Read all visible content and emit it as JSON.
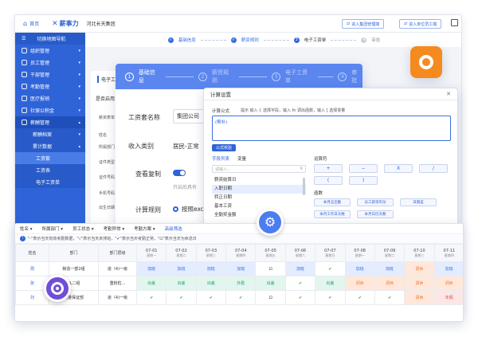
{
  "topbar": {
    "home": "首页",
    "brand": "薪事力",
    "company": "河北长天集团",
    "btn_group": "进入集团管理端",
    "btn_unit": "进入单位员工端"
  },
  "sidebar": {
    "toggle": "切换地图导航",
    "items": [
      {
        "label": "组织管理"
      },
      {
        "label": "员工管理"
      },
      {
        "label": "干部管理"
      },
      {
        "label": "考勤管理"
      },
      {
        "label": "医疗报销"
      },
      {
        "label": "社保公积金"
      },
      {
        "label": "薪酬管理"
      },
      {
        "label": "薪酬档案"
      },
      {
        "label": "累计数据"
      },
      {
        "label": "工资套"
      },
      {
        "label": "工资表"
      },
      {
        "label": "电子工资单"
      }
    ]
  },
  "steps": {
    "s1": "基础信息",
    "s2": "薪资规则",
    "s3": "电子工资单",
    "s4": "审批"
  },
  "bg_panel": {
    "tab": "电子工",
    "q": "是否启用",
    "labels": [
      "薪资表单",
      "姓名",
      "所属部门",
      "证件类型",
      "证件号码",
      "手机号码",
      "出生日期"
    ]
  },
  "mid": {
    "steps": [
      "基础信息",
      "薪资规则",
      "电子工资单",
      "审批"
    ],
    "name_label": "工资套名称",
    "name_value": "集团公司",
    "income_label": "收入类别",
    "income_value": "居民-正常",
    "copy_label": "查看复制",
    "copy_hint": "开启后具有",
    "rule_label": "计算规则",
    "rule_value": "按照exc"
  },
  "dialog": {
    "title": "计算设置",
    "formula_label": "计算公式",
    "hint": "提示 输入 { 选择字段，输入 fn 调出函数，输入 [ 选择变量",
    "placeholder": "(帮补)",
    "verify_btn": "公式校验",
    "tabs": [
      "字段列表",
      "变量"
    ],
    "search_placeholder": "请输入...",
    "fields": [
      "薪资结算日",
      "入职日期",
      "转正日期",
      "基本工资",
      "全勤奖金额"
    ],
    "ops_label": "运算符",
    "ops": [
      "+",
      "−",
      "X",
      "/",
      "(",
      ")"
    ],
    "func_label": "函数",
    "funcs": [
      "本月应出勤",
      "员工薪资年份",
      "日期差",
      "本月工作日天数",
      "本月日历天数"
    ]
  },
  "grid": {
    "filters": [
      "姓名",
      "所属部门",
      "员工状态",
      "考勤异常",
      "考勤方案",
      "高级筛选"
    ],
    "note": "\"-\"表示当天有效考勤数据，\"√\"表示当天未排班，\"✔\"表示当天考勤正常，\"⊡\"表示当天为休息日",
    "headers": [
      "姓名",
      "部门",
      "部门层级"
    ],
    "dates": [
      {
        "d": "07-01",
        "w": "星期一"
      },
      {
        "d": "07-02",
        "w": "星期二"
      },
      {
        "d": "07-03",
        "w": "星期三"
      },
      {
        "d": "07-04",
        "w": "星期四"
      },
      {
        "d": "07-05",
        "w": "星期五"
      },
      {
        "d": "07-06",
        "w": "星期六"
      },
      {
        "d": "07-07",
        "w": "星期日"
      },
      {
        "d": "07-08",
        "w": "星期一"
      },
      {
        "d": "07-09",
        "w": "星期二"
      },
      {
        "d": "07-10",
        "w": "星期三"
      },
      {
        "d": "07-11",
        "w": "星期四"
      }
    ],
    "rows": [
      {
        "name": "周",
        "dept": "制造一部2组",
        "level": "道（4)一级",
        "cells": [
          "加班",
          "加班",
          "加班",
          "加班",
          "⊡",
          "加班",
          "✔",
          "加班",
          "加班",
          "调休",
          "加班"
        ]
      },
      {
        "name": "张",
        "dept": "PL二组",
        "level": "重粉粒...",
        "cells": [
          "出差",
          "出差",
          "出差",
          "外勤",
          "出差",
          "✔",
          "出差",
          "调休",
          "调休",
          "调休",
          "调休"
        ]
      },
      {
        "name": "刘",
        "dept": "质量保证部",
        "level": "道（4)一级",
        "cells": [
          "✔",
          "✔",
          "✔",
          "✔",
          "⊡",
          "✔",
          "✔",
          "✔",
          "✔",
          "调休",
          "年假"
        ]
      }
    ]
  }
}
